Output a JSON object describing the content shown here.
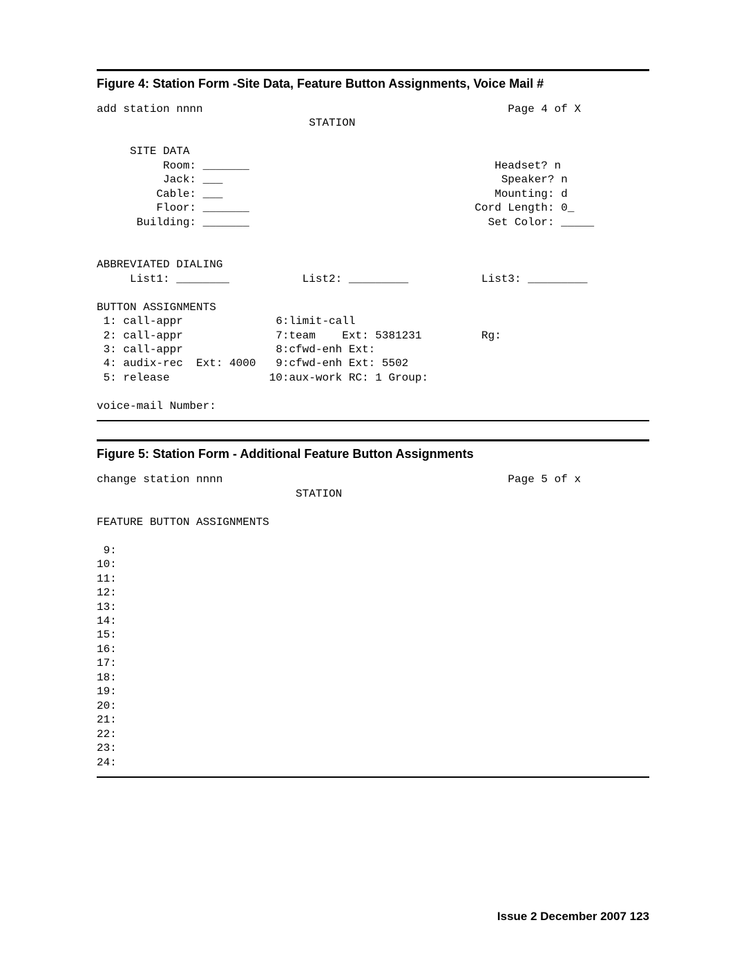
{
  "figure4": {
    "title": "Figure 4: Station Form -Site Data, Feature Button Assignments, Voice Mail #",
    "command_line": "add station nnnn                                              Page 4 of X",
    "form_title": "                                STATION",
    "site_data_header": "     SITE DATA",
    "site_left": [
      "          Room: _______                                     Headset? n",
      "          Jack: ___                                          Speaker? n",
      "         Cable: ___                                         Mounting: d",
      "         Floor: _______                                  Cord Length: 0_",
      "      Building: _______                                    Set Color: _____"
    ],
    "abbrev_header": "ABBREVIATED DIALING",
    "abbrev_line": "     List1: ________           List2: _________           List3: _________",
    "buttons_header": "BUTTON ASSIGNMENTS",
    "button_lines": [
      " 1: call-appr              6:limit-call",
      " 2: call-appr              7:team    Ext: 5381231         Rg:",
      " 3: call-appr              8:cfwd-enh Ext:",
      " 4: audix-rec  Ext: 4000   9:cfwd-enh Ext: 5502",
      " 5: release               10:aux-work RC: 1 Group:"
    ],
    "voice_mail_line": "voice-mail Number:"
  },
  "figure5": {
    "title": "Figure 5: Station Form - Additional Feature Button Assignments",
    "command_line": "change station nnnn                                           Page 5 of x",
    "form_title": "                              STATION",
    "section_header": "FEATURE BUTTON ASSIGNMENTS",
    "rows": [
      " 9:",
      "10:",
      "11:",
      "12:",
      "13:",
      "14:",
      "15:",
      "16:",
      "17:",
      "18:",
      "19:",
      "20:",
      "21:",
      "22:",
      "23:",
      "24:"
    ]
  },
  "footer": "Issue 2   December 2007    123"
}
